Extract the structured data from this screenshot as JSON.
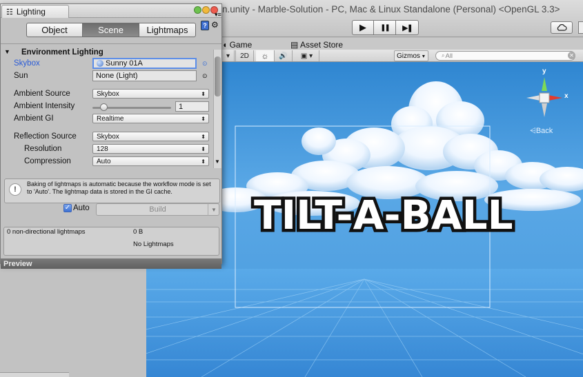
{
  "window_title": "n.unity - Marble-Solution - PC, Mac & Linux Standalone (Personal) <OpenGL 3.3>",
  "playbar": {
    "play": "▶",
    "pause": "❚❚",
    "step": "▶❚"
  },
  "tabs": {
    "game": "Game",
    "asset_store": "Asset Store"
  },
  "scene_toolbar": {
    "mode_2d": "2D",
    "gizmos": "Gizmos",
    "search_placeholder": "All"
  },
  "gizmo": {
    "y": "y",
    "x": "x",
    "back": "Back"
  },
  "game_logo": "TILT-A-BALL",
  "lighting": {
    "tab_title": "Lighting",
    "segments": [
      "Object",
      "Scene",
      "Lightmaps"
    ],
    "active_segment": "Scene",
    "env_header": "Environment Lighting",
    "skybox_label": "Skybox",
    "skybox_value": "Sunny 01A",
    "sun_label": "Sun",
    "sun_value": "None (Light)",
    "ambient_source_label": "Ambient Source",
    "ambient_source_value": "Skybox",
    "ambient_intensity_label": "Ambient Intensity",
    "ambient_intensity_value": "1",
    "ambient_gi_label": "Ambient GI",
    "ambient_gi_value": "Realtime",
    "reflection_source_label": "Reflection Source",
    "reflection_source_value": "Skybox",
    "resolution_label": "Resolution",
    "resolution_value": "128",
    "compression_label": "Compression",
    "compression_value": "Auto",
    "info_text": "Baking of lightmaps is automatic because the workflow mode is set to 'Auto'. The lightmap data is stored in the GI cache.",
    "auto_label": "Auto",
    "build_label": "Build",
    "stats_label": "0 non-directional lightmaps",
    "stats_size": "0 B",
    "stats_none": "No Lightmaps",
    "preview_label": "Preview"
  },
  "colors": {
    "accent": "#2a5bd7",
    "sky_top": "#2f86d1",
    "sky_bottom": "#3d8fd8"
  }
}
